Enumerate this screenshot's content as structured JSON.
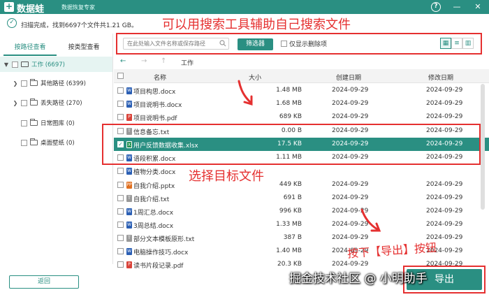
{
  "app": {
    "logo_glyph": "+",
    "name": "数据蛙",
    "subtitle": "数据恢复专家"
  },
  "window_controls": {
    "help": "?",
    "minimize": "—",
    "close": "✕"
  },
  "scan": {
    "status": "扫描完成，找到6697个文件共1.21 GB。"
  },
  "annotations": {
    "title": "可以用搜索工具辅助自己搜索文件",
    "select": "选择目标文件",
    "press": "按下【导出】按钮"
  },
  "toolbar": {
    "search_placeholder": "在此处输入文件名称或保存路径",
    "filter_label": "筛选器",
    "show_deleted_label": "仅显示删除项"
  },
  "sidebar": {
    "tabs": [
      {
        "label": "按路径查看"
      },
      {
        "label": "按类型查看"
      }
    ],
    "items": [
      {
        "label": "工作 (6697)"
      },
      {
        "label": "其他路径 (6399)"
      },
      {
        "label": "丢失路径 (270)"
      },
      {
        "label": "日常图库 (0)"
      },
      {
        "label": "桌面壁纸 (0)"
      }
    ],
    "back_label": "返回"
  },
  "nav": {
    "breadcrumb": "工作"
  },
  "table": {
    "headers": {
      "name": "名称",
      "size": "大小",
      "created": "创建日期",
      "modified": "修改日期"
    },
    "rows": [
      {
        "name": "项目构思.docx",
        "size": "1.48 MB",
        "created": "2024-09-29",
        "modified": "2024-09-29",
        "type": "W"
      },
      {
        "name": "项目说明书.docx",
        "size": "1.68 MB",
        "created": "2024-09-29",
        "modified": "2024-09-29",
        "type": "W"
      },
      {
        "name": "项目说明书.pdf",
        "size": "689 KB",
        "created": "2024-09-29",
        "modified": "2024-09-29",
        "type": "P"
      },
      {
        "name": "信息备忘.txt",
        "size": "0.00  B",
        "created": "2024-09-29",
        "modified": "2024-09-29",
        "type": "T"
      },
      {
        "name": "用户反馈数据收集.xlsx",
        "size": "17.5 KB",
        "created": "2024-09-29",
        "modified": "2024-09-29",
        "type": "X"
      },
      {
        "name": "语段积累.docx",
        "size": "1.11 MB",
        "created": "2024-09-29",
        "modified": "2024-09-29",
        "type": "W"
      },
      {
        "name": "植物分类.docx",
        "size": "",
        "created": "",
        "modified": "",
        "type": "W"
      },
      {
        "name": "自我介绍.pptx",
        "size": "449 KB",
        "created": "2024-09-29",
        "modified": "2024-09-29",
        "type": "PP"
      },
      {
        "name": "自我介绍.txt",
        "size": "691  B",
        "created": "2024-09-29",
        "modified": "2024-09-29",
        "type": "T"
      },
      {
        "name": "1周汇总.docx",
        "size": "996 KB",
        "created": "2024-09-29",
        "modified": "2024-09-29",
        "type": "W"
      },
      {
        "name": "3周总结.docx",
        "size": "1.33 MB",
        "created": "2024-09-29",
        "modified": "2024-09-29",
        "type": "W"
      },
      {
        "name": "部分文本模板原形.txt",
        "size": "387  B",
        "created": "2024-09-29",
        "modified": "2024-09-29",
        "type": "T"
      },
      {
        "name": "电脑操作技巧.docx",
        "size": "1.40 MB",
        "created": "2024-09-29",
        "modified": "2024-09-29",
        "type": "W"
      },
      {
        "name": "读书片段记录.pdf",
        "size": "20.3 KB",
        "created": "2024-09-29",
        "modified": "2024-09-29",
        "type": "P"
      }
    ]
  },
  "export": {
    "label": "导出"
  },
  "watermark": "掘金技术社区 @ 小明助手",
  "colors": {
    "accent": "#2a8f82",
    "annotation": "#e53030",
    "word": "#2b5fb4",
    "pdf": "#d9433a",
    "excel": "#1f8f4e",
    "ppt": "#e07020",
    "txt": "#9a9a9a"
  }
}
